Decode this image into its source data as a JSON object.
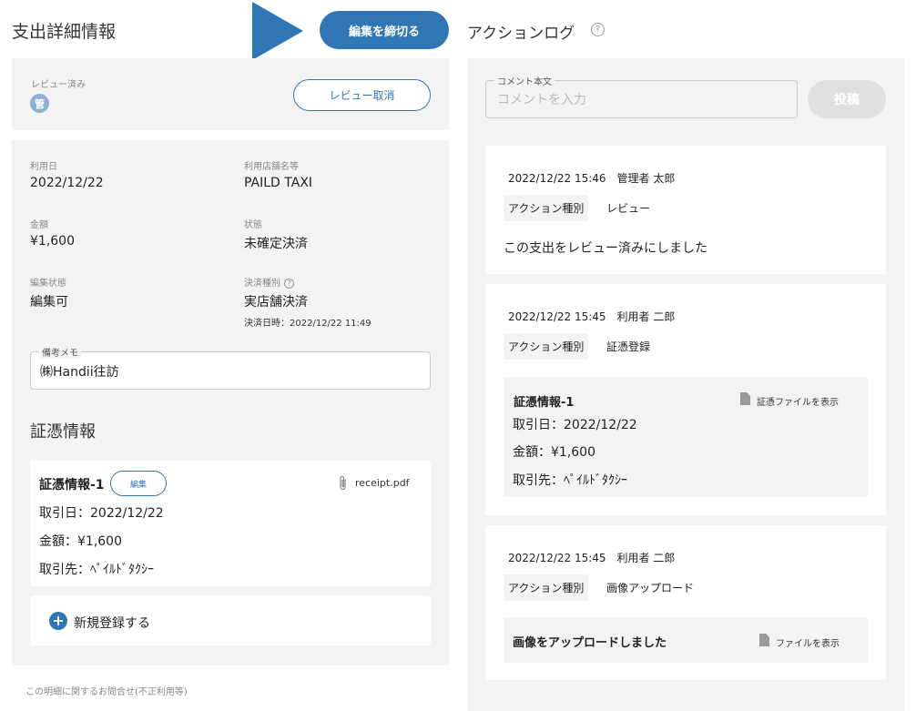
{
  "header": {
    "title": "支出詳細情報",
    "finish_button": "編集を締切る"
  },
  "review": {
    "label": "レビュー済み",
    "badge": "管",
    "cancel_button": "レビュー取消"
  },
  "details": {
    "use_date_label": "利用日",
    "use_date": "2022/12/22",
    "store_label": "利用店舗名等",
    "store": "PAILD TAXI",
    "amount_label": "金額",
    "amount": "¥1,600",
    "status_label": "状態",
    "status": "未確定決済",
    "edit_status_label": "編集状態",
    "edit_status": "編集可",
    "payment_type_label": "決済種別",
    "payment_type": "実店舗決済",
    "payment_datetime": "決済日時：2022/12/22 11:49",
    "help_icon": "?"
  },
  "memo": {
    "legend": "備考メモ",
    "value": "㈱Handii往訪"
  },
  "evidence": {
    "section_title": "証憑情報",
    "card_title": "証憑情報-1",
    "edit_button": "編集",
    "file_name": "receipt.pdf",
    "lines": [
      "取引日：2022/12/22",
      "金額：¥1,600",
      "取引先：ﾍﾟｲﾙﾄﾞﾀｸｼｰ"
    ],
    "new_register": "新規登録する",
    "plus_icon": "+"
  },
  "footer": {
    "contact_label": "この明細に関するお問合せ(不正利用等)"
  },
  "action_log": {
    "title": "アクションログ",
    "help_icon": "?",
    "comment_legend": "コメント本文",
    "comment_placeholder": "コメントを入力",
    "post_button": "投稿",
    "entries": [
      {
        "meta": "2022/12/22 15:46　管理者 太郎",
        "tag_label": "アクション種別",
        "tag_value": "レビュー",
        "message": "この支出をレビュー済みにしました"
      },
      {
        "meta": "2022/12/22 15:45　利用者 二郎",
        "tag_label": "アクション種別",
        "tag_value": "証憑登録",
        "inner_title": "証憑情報-1",
        "show_file": "証憑ファイルを表示",
        "inner_lines": [
          "取引日：2022/12/22",
          "金額：¥1,600",
          "取引先：ﾍﾟｲﾙﾄﾞﾀｸｼｰ"
        ]
      },
      {
        "meta": "2022/12/22 15:45　利用者 二郎",
        "tag_label": "アクション種別",
        "tag_value": "画像アップロード",
        "inner_title": "画像をアップロードしました",
        "show_file": "ファイルを表示"
      }
    ]
  },
  "colors": {
    "primary": "#2f76b5",
    "panel_bg": "#f3f3f3",
    "badge": "#8fb0d6"
  }
}
